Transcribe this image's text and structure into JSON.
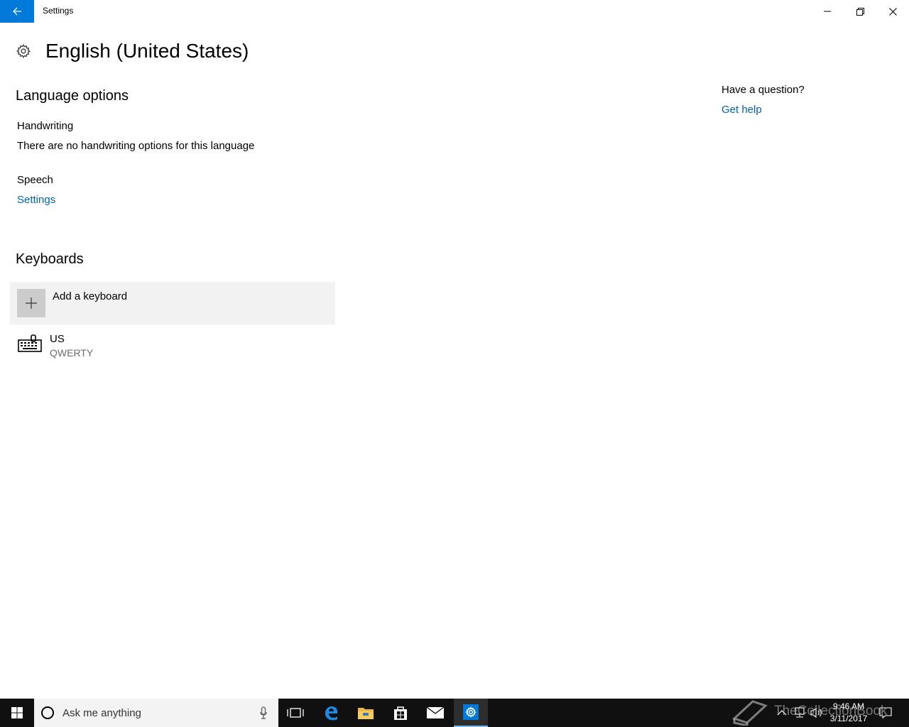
{
  "window": {
    "title": "Settings"
  },
  "page": {
    "title": "English (United States)"
  },
  "language_options": {
    "heading": "Language options",
    "handwriting_label": "Handwriting",
    "handwriting_text": "There are no handwriting options for this language",
    "speech_label": "Speech",
    "speech_link": "Settings"
  },
  "keyboards": {
    "heading": "Keyboards",
    "add_label": "Add a keyboard",
    "items": [
      {
        "name": "US",
        "layout": "QWERTY"
      }
    ]
  },
  "help": {
    "question": "Have a question?",
    "link": "Get help"
  },
  "taskbar": {
    "search_placeholder": "Ask me anything",
    "time": "9:46 AM",
    "date": "3/11/2017",
    "watermark": "TheCollectionBook"
  },
  "colors": {
    "accent": "#0078d7",
    "link": "#0063b1"
  }
}
